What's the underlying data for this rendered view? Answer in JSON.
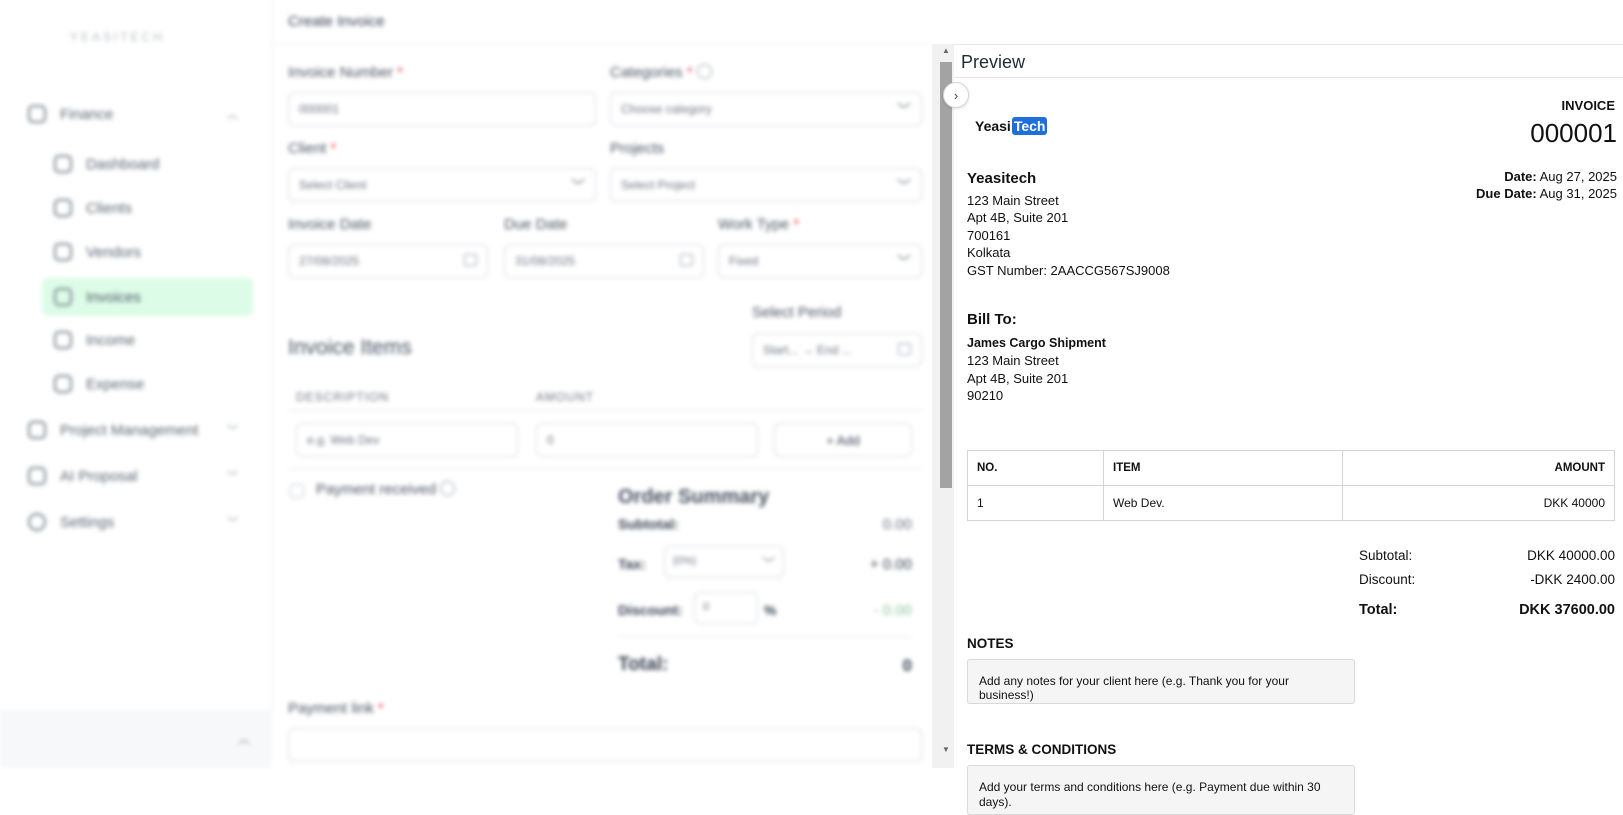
{
  "sidebar": {
    "logo_text": "YEASITECH",
    "items": [
      {
        "label": "Finance"
      },
      {
        "label": "Dashboard"
      },
      {
        "label": "Clients"
      },
      {
        "label": "Vendors"
      },
      {
        "label": "Invoices"
      },
      {
        "label": "Income"
      },
      {
        "label": "Expense"
      },
      {
        "label": "Project Management"
      },
      {
        "label": "AI Proposal"
      },
      {
        "label": "Settings"
      }
    ],
    "active": "Invoices",
    "accent_color": "#dcfce7"
  },
  "form": {
    "page_title": "Create Invoice",
    "invoice_number_label": "Invoice Number",
    "invoice_number_value": "000001",
    "categories_label": "Categories",
    "categories_placeholder": "Choose category",
    "client_label": "Client",
    "client_placeholder": "Select Client",
    "projects_label": "Projects",
    "projects_placeholder": "Select Project",
    "invoice_date_label": "Invoice Date",
    "invoice_date_value": "27/08/2025",
    "due_date_label": "Due Date",
    "due_date_value": "31/08/2025",
    "work_type_label": "Work Type",
    "work_type_value": "Fixed",
    "select_period_label": "Select Period",
    "period_start": "Start...",
    "period_arrow": "→",
    "period_end": "End ...",
    "items_title": "Invoice Items",
    "col_description": "DESCRIPTION",
    "col_amount": "AMOUNT",
    "description_placeholder": "e.g. Web Dev",
    "amount_value": "0",
    "add_button": "+ Add",
    "payment_received_label": "Payment received",
    "order_summary_title": "Order Summary",
    "subtotal_label": "Subtotal:",
    "subtotal_value": "0.00",
    "tax_label": "Tax:",
    "tax_select": "(0%)",
    "tax_value": "+ 0.00",
    "discount_label": "Discount:",
    "discount_input": "0",
    "discount_unit": "%",
    "discount_value": "- 0.00",
    "total_label": "Total:",
    "total_value": "0",
    "payment_link_label": "Payment link",
    "required_mark": "*"
  },
  "preview": {
    "header": "Preview",
    "collapse_icon": "chevron-right-icon",
    "invoice": {
      "logo_part1": "Yeasi",
      "logo_part2": "Tech",
      "title": "INVOICE",
      "number": "000001",
      "date_label": "Date:",
      "date_value": "Aug 27, 2025",
      "due_label": "Due Date:",
      "due_value": "Aug 31, 2025",
      "from": {
        "name": "Yeasitech",
        "line1": "123 Main Street",
        "line2": "Apt 4B, Suite 201",
        "line3": "700161",
        "line4": "Kolkata",
        "gst": "GST Number: 2AACCG567SJ9008"
      },
      "bill_to": {
        "heading": "Bill To:",
        "name": "James Cargo Shipment",
        "line1": "123 Main Street",
        "line2": "Apt 4B, Suite 201",
        "line3": "90210"
      },
      "table": {
        "headers": [
          "NO.",
          "ITEM",
          "AMOUNT"
        ],
        "rows": [
          [
            "1",
            "Web Dev.",
            "DKK 40000"
          ]
        ]
      },
      "subtotal_label": "Subtotal:",
      "subtotal_value": "DKK 40000.00",
      "discount_label": "Discount:",
      "discount_value": "-DKK 2400.00",
      "total_label": "Total:",
      "total_value": "DKK 37600.00",
      "notes_heading": "NOTES",
      "notes_text": "Add any notes for your client here (e.g. Thank you for your business!)",
      "terms_heading": "TERMS & CONDITIONS",
      "terms_text": "Add your terms and conditions here (e.g. Payment due within 30 days)."
    }
  }
}
